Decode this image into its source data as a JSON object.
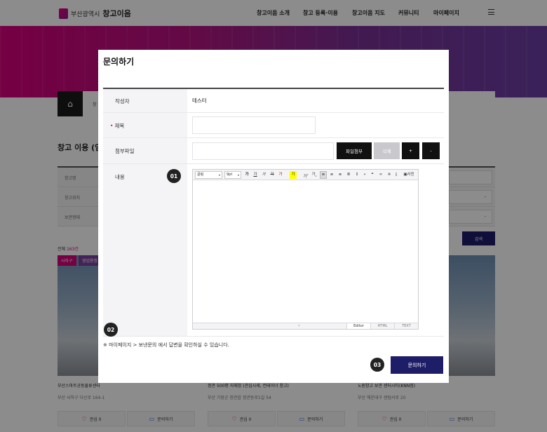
{
  "header": {
    "logo_city": "부산광역시",
    "logo_name": "창고이음",
    "nav": [
      "창고이음 소개",
      "창고 등록·이용",
      "창고이음 지도",
      "커뮤니티",
      "마이페이지"
    ]
  },
  "page": {
    "breadcrumb_partial": "창",
    "title_partial": "창고 이용 (임",
    "filters": [
      "창고명",
      "창고위치",
      "보관형태"
    ],
    "filter_value": "-",
    "search_label": "검색",
    "total_prefix": "전체",
    "total_count": "163건"
  },
  "cards": [
    {
      "tags": [
        "사하구",
        "영업용창고"
      ],
      "title": "부산스마트공동물류센터",
      "address": "부산 사하구 다산로 164-1",
      "like_label": "관심 0",
      "inquiry_label": "문의하기"
    },
    {
      "tags": [],
      "title": "정관 500평 자체창 (관심시세, 컨테이너 창고)",
      "address": "부산 기장군 정관읍 정관동로1길 54",
      "like_label": "관심 0",
      "inquiry_label": "문의하기"
    },
    {
      "tags": [],
      "title": "노원창고 보관 센터시티(KNN점)",
      "address": "부산 해운대구 센텀서로 20",
      "like_label": "관심 0",
      "inquiry_label": "문의하기"
    }
  ],
  "modal": {
    "title": "문의하기",
    "fields": {
      "writer_label": "작성자",
      "writer_value": "테스터",
      "subject_label": "제목",
      "attach_label": "첨부파일",
      "content_label": "내용"
    },
    "buttons": {
      "file_attach": "파일첨부",
      "delete": "삭제",
      "plus": "+",
      "minus": "-",
      "submit": "문의하기"
    },
    "editor": {
      "font_family": "굴림",
      "font_size": "9pt",
      "toolbar_glyphs": [
        "가",
        "가",
        "가",
        "가",
        "가",
        "가",
        "가",
        "가",
        "가"
      ],
      "photo_label": "사진",
      "tabs": [
        "Editor",
        "HTML",
        "TEXT"
      ]
    },
    "notice": "※ 마이페이지 > 보낸문의 에서 답변을 확인하실 수 있습니다.",
    "badges": [
      "01",
      "02",
      "03"
    ]
  },
  "colors": {
    "accent_magenta": "#e6007e",
    "navy_button": "#1e1d68"
  }
}
